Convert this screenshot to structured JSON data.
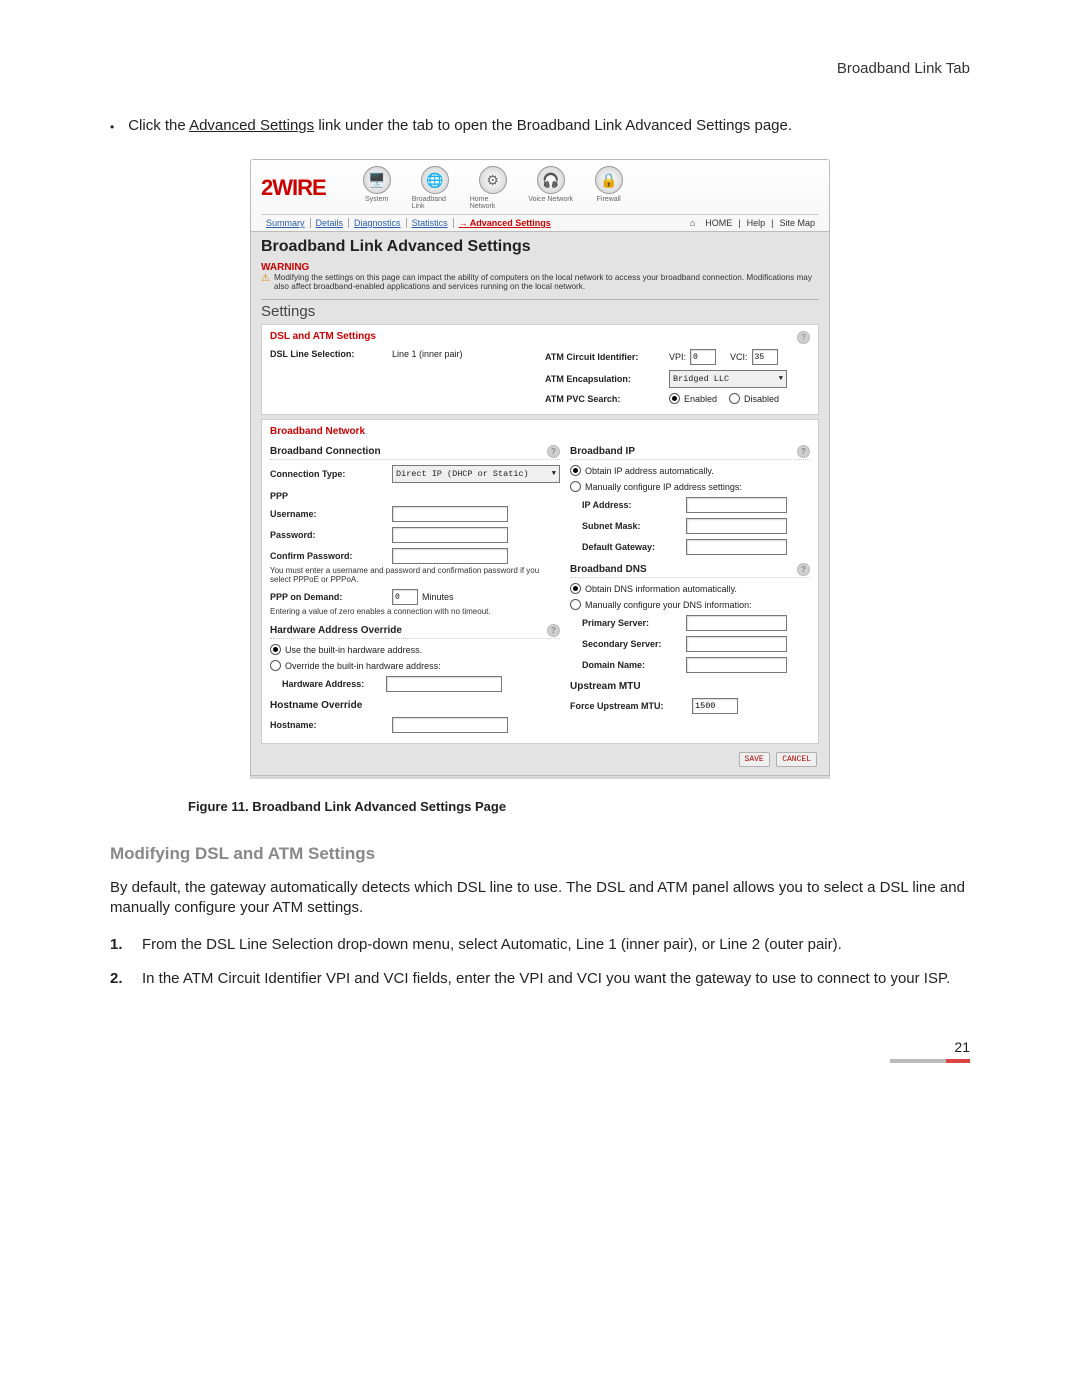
{
  "header": {
    "page_tab": "Broadband Link Tab"
  },
  "intro": {
    "bullet": "•",
    "pre": "Click the ",
    "link": "Advanced Settings",
    "post": " link under the tab to open the Broadband Link Advanced Settings page."
  },
  "ui": {
    "logo": "2WIRE",
    "nav": [
      {
        "label": "System",
        "glyph": "🖥️"
      },
      {
        "label": "Broadband Link",
        "glyph": "🌐"
      },
      {
        "label": "Home Network",
        "glyph": "⚙"
      },
      {
        "label": "Voice Network",
        "glyph": "🎧"
      },
      {
        "label": "Firewall",
        "glyph": "🔒"
      }
    ],
    "subtabs": [
      "Summary",
      "Details",
      "Diagnostics",
      "Statistics",
      "Advanced Settings"
    ],
    "toplinks": {
      "home": "HOME",
      "help": "Help",
      "sitemap": "Site Map"
    },
    "title": "Broadband Link Advanced Settings",
    "warning_label": "WARNING",
    "warning_text": "Modifying the settings on this page can impact the ability of computers on the local network to access your broadband connection. Modifications may also affect broadband-enabled applications and services running on the local network.",
    "settings_label": "Settings",
    "dsl": {
      "hdr": "DSL and ATM Settings",
      "dsl_line_lbl": "DSL Line Selection:",
      "dsl_line_val": "Line 1 (inner pair)",
      "atm_ci_lbl": "ATM Circuit Identifier:",
      "vpi_lbl": "VPI:",
      "vpi_val": "0",
      "vci_lbl": "VCI:",
      "vci_val": "35",
      "atm_enc_lbl": "ATM Encapsulation:",
      "atm_enc_val": "Bridged LLC",
      "atm_pvc_lbl": "ATM PVC Search:",
      "enabled": "Enabled",
      "disabled": "Disabled"
    },
    "bn": {
      "hdr": "Broadband Network",
      "bc_hdr": "Broadband Connection",
      "conn_type_lbl": "Connection Type:",
      "conn_type_val": "Direct IP (DHCP or Static)",
      "ppp_hdr": "PPP",
      "user_lbl": "Username:",
      "pass_lbl": "Password:",
      "cpass_lbl": "Confirm Password:",
      "ppp_note": "You must enter a username and password and confirmation password if you select PPPoE or PPPoA.",
      "pod_lbl": "PPP on Demand:",
      "pod_val": "0",
      "pod_unit": "Minutes",
      "pod_note": "Entering a value of zero enables a connection with no timeout.",
      "hao_hdr": "Hardware Address Override",
      "hao_r1": "Use the built-in hardware address.",
      "hao_r2": "Override the built-in hardware address:",
      "hao_lbl": "Hardware Address:",
      "ho_hdr": "Hostname Override",
      "ho_lbl": "Hostname:"
    },
    "bip": {
      "hdr": "Broadband IP",
      "r1": "Obtain IP address automatically.",
      "r2": "Manually configure IP address settings:",
      "ip_lbl": "IP Address:",
      "sm_lbl": "Subnet Mask:",
      "gw_lbl": "Default Gateway:"
    },
    "bdns": {
      "hdr": "Broadband DNS",
      "r1": "Obtain DNS information automatically.",
      "r2": "Manually configure your DNS information:",
      "ps_lbl": "Primary Server:",
      "ss_lbl": "Secondary Server:",
      "dn_lbl": "Domain Name:"
    },
    "mtu": {
      "hdr": "Upstream MTU",
      "lbl": "Force Upstream MTU:",
      "val": "1500"
    },
    "buttons": {
      "save": "SAVE",
      "cancel": "CANCEL"
    }
  },
  "figure_caption": "Figure 11. Broadband Link Advanced Settings Page",
  "section": {
    "heading": "Modifying DSL and ATM Settings",
    "para": "By default, the gateway automatically detects which DSL line to use. The DSL and ATM panel allows you to select a DSL line and manually configure your ATM settings.",
    "steps": [
      "From the DSL Line Selection drop-down menu, select Automatic, Line 1 (inner pair), or Line 2 (outer pair).",
      "In the ATM Circuit Identifier VPI and VCI fields, enter the VPI and VCI you want the gateway to use to connect to your ISP."
    ]
  },
  "page_number": "21"
}
